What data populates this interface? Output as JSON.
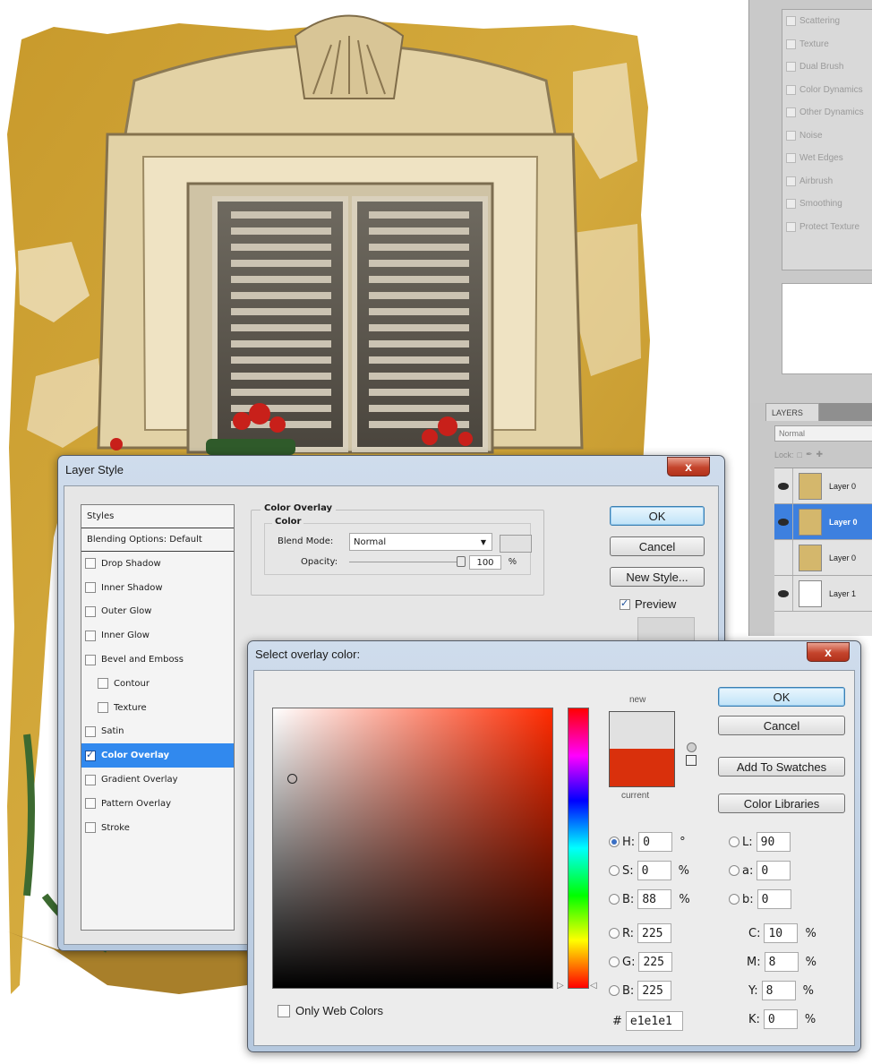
{
  "brush_panel": {
    "options": [
      "Scattering",
      "Texture",
      "Dual Brush",
      "Color Dynamics",
      "Other Dynamics",
      "Noise",
      "Wet Edges",
      "Airbrush",
      "Smoothing",
      "Protect Texture"
    ]
  },
  "layers_panel": {
    "tab": "LAYERS",
    "blend_mode": "Normal",
    "lock_label": "Lock:",
    "layers": [
      {
        "name": "Layer 0",
        "selected": false,
        "visible": true
      },
      {
        "name": "Layer 0",
        "selected": true,
        "visible": true
      },
      {
        "name": "Layer 0",
        "selected": false,
        "visible": false
      },
      {
        "name": "Layer 1",
        "selected": false,
        "visible": true
      }
    ]
  },
  "layer_style": {
    "title": "Layer Style",
    "close": "x",
    "styles_header": "Styles",
    "blending_options": "Blending Options: Default",
    "items": [
      {
        "label": "Drop Shadow",
        "checked": false,
        "sub": false
      },
      {
        "label": "Inner Shadow",
        "checked": false,
        "sub": false
      },
      {
        "label": "Outer Glow",
        "checked": false,
        "sub": false
      },
      {
        "label": "Inner Glow",
        "checked": false,
        "sub": false
      },
      {
        "label": "Bevel and Emboss",
        "checked": false,
        "sub": false
      },
      {
        "label": "Contour",
        "checked": false,
        "sub": true
      },
      {
        "label": "Texture",
        "checked": false,
        "sub": true
      },
      {
        "label": "Satin",
        "checked": false,
        "sub": false
      },
      {
        "label": "Color Overlay",
        "checked": true,
        "sub": false,
        "selected": true
      },
      {
        "label": "Gradient Overlay",
        "checked": false,
        "sub": false
      },
      {
        "label": "Pattern Overlay",
        "checked": false,
        "sub": false
      },
      {
        "label": "Stroke",
        "checked": false,
        "sub": false
      }
    ],
    "section_title": "Color Overlay",
    "group_title": "Color",
    "blend_mode_label": "Blend Mode:",
    "blend_mode_value": "Normal",
    "opacity_label": "Opacity:",
    "opacity_value": "100",
    "opacity_unit": "%",
    "opacity_level": 1.0,
    "overlay_color": "#e1e1e1",
    "buttons": {
      "ok": "OK",
      "cancel": "Cancel",
      "new_style": "New Style..."
    },
    "preview_label": "Preview",
    "preview_checked": true
  },
  "color_picker": {
    "title": "Select overlay color:",
    "close": "x",
    "new_label": "new",
    "current_label": "current",
    "new_color": "#e1e1e1",
    "current_color": "#d9300c",
    "buttons": {
      "ok": "OK",
      "cancel": "Cancel",
      "add_to_swatches": "Add To Swatches",
      "color_libraries": "Color Libraries"
    },
    "hsb": [
      {
        "label": "H:",
        "value": "0",
        "unit": "°",
        "selected": true
      },
      {
        "label": "S:",
        "value": "0",
        "unit": "%",
        "selected": false
      },
      {
        "label": "B:",
        "value": "88",
        "unit": "%",
        "selected": false
      }
    ],
    "rgb": [
      {
        "label": "R:",
        "value": "225"
      },
      {
        "label": "G:",
        "value": "225"
      },
      {
        "label": "B:",
        "value": "225"
      }
    ],
    "lab": [
      {
        "label": "L:",
        "value": "90"
      },
      {
        "label": "a:",
        "value": "0"
      },
      {
        "label": "b:",
        "value": "0"
      }
    ],
    "cmyk": [
      {
        "label": "C:",
        "value": "10",
        "unit": "%"
      },
      {
        "label": "M:",
        "value": "8",
        "unit": "%"
      },
      {
        "label": "Y:",
        "value": "8",
        "unit": "%"
      },
      {
        "label": "K:",
        "value": "0",
        "unit": "%"
      }
    ],
    "hex_label": "#",
    "hex_value": "e1e1e1",
    "only_web_colors": "Only Web Colors"
  }
}
